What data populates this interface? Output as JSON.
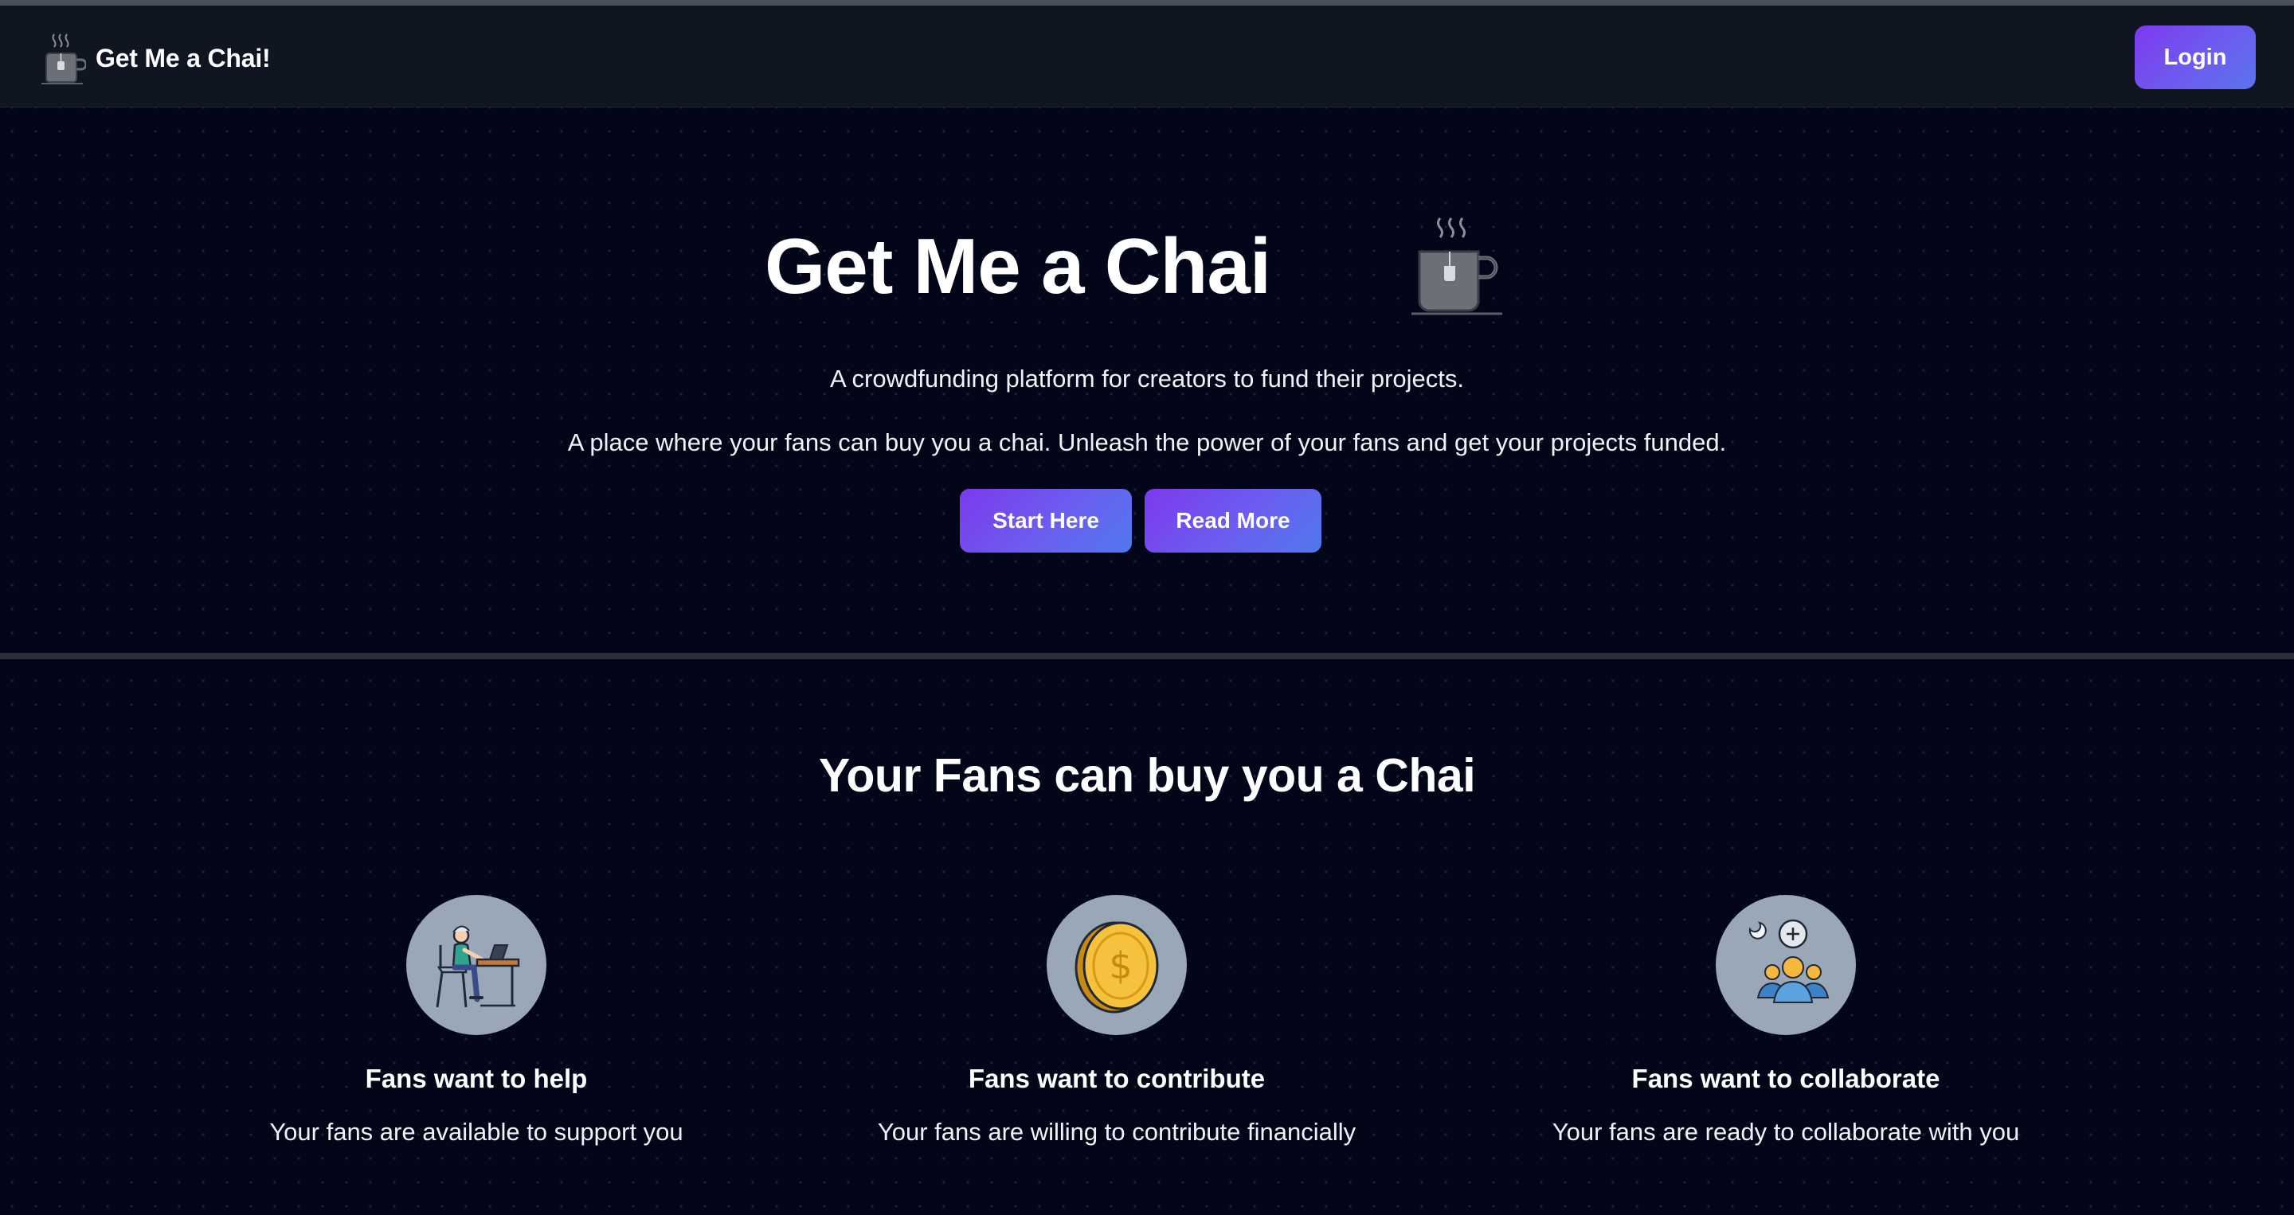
{
  "colors": {
    "background": "#030619",
    "navbar": "#101522",
    "accent_start": "#7c3aed",
    "accent_end": "#4f79ee",
    "divider": "#2b3038",
    "feature_circle": "#9aa7b6"
  },
  "navbar": {
    "logo_icon": "tea-cup-icon",
    "brand": "Get Me a Chai!",
    "login_label": "Login"
  },
  "hero": {
    "title": "Get Me a Chai",
    "icon": "tea-cup-icon",
    "line1": "A crowdfunding platform for creators to fund their projects.",
    "line2": "A place where your fans can buy you a chai. Unleash the power of your fans and get your projects funded.",
    "start_label": "Start Here",
    "read_more_label": "Read More"
  },
  "features_section": {
    "title": "Your Fans can buy you a Chai",
    "items": [
      {
        "icon": "person-at-desk-icon",
        "title": "Fans want to help",
        "description": "Your fans are available to support you"
      },
      {
        "icon": "dollar-coin-icon",
        "title": "Fans want to contribute",
        "description": "Your fans are willing to contribute financially"
      },
      {
        "icon": "group-collaborate-icon",
        "title": "Fans want to collaborate",
        "description": "Your fans are ready to collaborate with you"
      }
    ]
  }
}
